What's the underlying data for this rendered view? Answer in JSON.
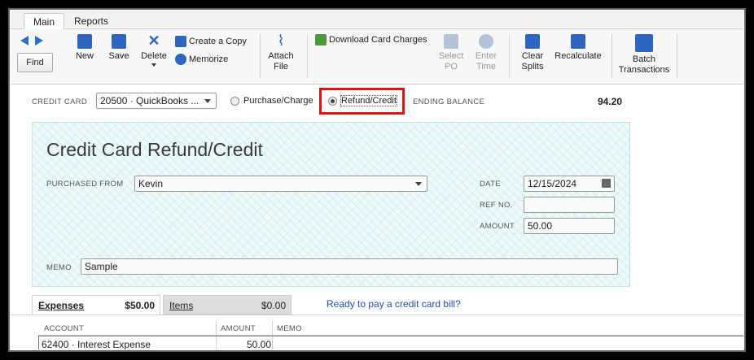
{
  "tabs": [
    "Main",
    "Reports"
  ],
  "toolbar": {
    "find": "Find",
    "new": "New",
    "save": "Save",
    "delete": "Delete",
    "create_copy": "Create a Copy",
    "memorize": "Memorize",
    "attach_file_1": "Attach",
    "attach_file_2": "File",
    "download_card_charges": "Download Card Charges",
    "select_po_1": "Select",
    "select_po_2": "PO",
    "enter_time_1": "Enter",
    "enter_time_2": "Time",
    "clear_splits_1": "Clear",
    "clear_splits_2": "Splits",
    "recalculate": "Recalculate",
    "batch_1": "Batch",
    "batch_2": "Transactions"
  },
  "header": {
    "credit_card_label": "CREDIT CARD",
    "credit_card_value": "20500 · QuickBooks ...",
    "purchase_charge": "Purchase/Charge",
    "refund_credit": "Refund/Credit",
    "ending_balance_label": "ENDING BALANCE",
    "ending_balance_value": "94.20"
  },
  "form": {
    "title": "Credit Card Refund/Credit",
    "purchased_from_label": "PURCHASED FROM",
    "purchased_from_value": "Kevin",
    "date_label": "DATE",
    "date_value": "12/15/2024",
    "ref_label": "REF NO.",
    "ref_value": "",
    "amount_label": "AMOUNT",
    "amount_value": "50.00",
    "memo_label": "MEMO",
    "memo_value": "Sample"
  },
  "detail": {
    "expenses_tab": "Expenses",
    "expenses_total": "$50.00",
    "items_tab": "Items",
    "items_total": "$0.00",
    "pay_link": "Ready to pay a credit card bill?",
    "columns": [
      "ACCOUNT",
      "AMOUNT",
      "MEMO"
    ],
    "row": {
      "account": "62400 · Interest Expense",
      "amount": "50.00",
      "memo": ""
    }
  },
  "colors": {
    "highlight": "#e01010",
    "link": "#1f56b3",
    "card_bg": "#eef9f9"
  }
}
